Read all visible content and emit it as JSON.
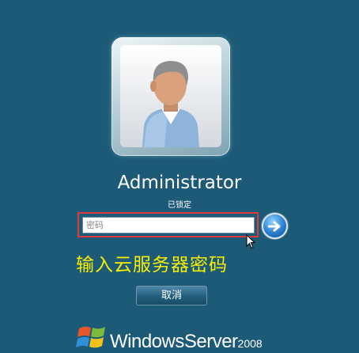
{
  "user": {
    "name": "Administrator",
    "status": "已锁定"
  },
  "login": {
    "password_placeholder": "密码"
  },
  "annotation": {
    "instruction": "输入云服务器密码"
  },
  "buttons": {
    "cancel_label": "取消"
  },
  "branding": {
    "product": "WindowsServer",
    "version": "2008"
  },
  "colors": {
    "background": "#1d5a78",
    "highlight_box": "#e03b3b",
    "instruction_text": "#f6f000"
  },
  "icons": {
    "user_avatar": "user-avatar-icon",
    "submit": "arrow-right-icon",
    "logo": "windows-flag-icon",
    "cursor": "mouse-cursor-icon"
  }
}
